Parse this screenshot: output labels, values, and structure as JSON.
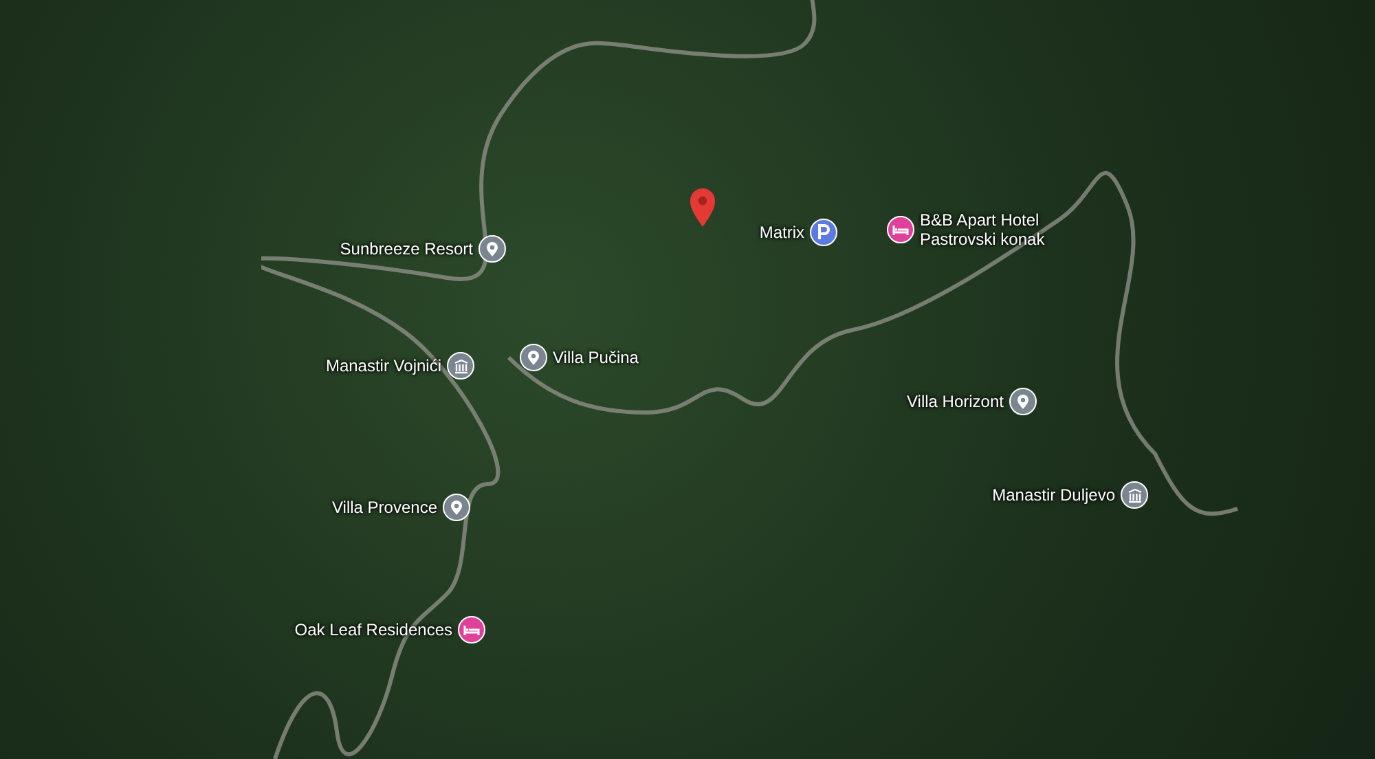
{
  "map": {
    "places": [
      {
        "kind": "resort",
        "name": "Sunbreeze Resort"
      },
      {
        "kind": "parking",
        "name": "Matrix"
      },
      {
        "kind": "hotel",
        "name": "B&B Apart Hotel\nPastrovski konak"
      },
      {
        "kind": "landmark",
        "name": "Manastir Vojnići"
      },
      {
        "kind": "resort",
        "name": "Villa Pučina"
      },
      {
        "kind": "resort",
        "name": "Villa Horizont"
      },
      {
        "kind": "landmark",
        "name": "Manastir Duljevo"
      },
      {
        "kind": "resort",
        "name": "Villa Provence"
      },
      {
        "kind": "hotel",
        "name": "Oak Leaf Residences"
      }
    ]
  }
}
